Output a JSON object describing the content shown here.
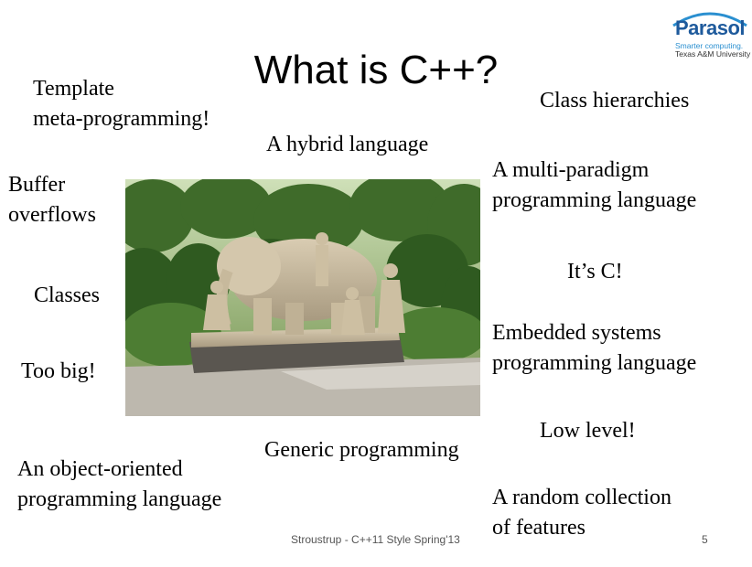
{
  "title": "What is C++?",
  "logo": {
    "name": "Parasol",
    "tagline_line1": "Smarter computing.",
    "tagline_line2": "Texas A&M University",
    "color_primary": "#1e5a9c",
    "color_tagline1": "#2a8fd0"
  },
  "phrases": {
    "template_meta": "Template\nmeta-programming!",
    "class_hierarchies": "Class hierarchies",
    "hybrid": "A hybrid language",
    "multi_paradigm": "A multi-paradigm\nprogramming language",
    "buffer": "Buffer\noverflows",
    "its_c": "It’s C!",
    "classes": "Classes",
    "embedded": "Embedded systems\nprogramming language",
    "too_big": "Too big!",
    "low_level": "Low level!",
    "generic": "Generic programming",
    "object_oriented": "An object-oriented\nprogramming language",
    "random": "A random collection\nof features"
  },
  "footer": {
    "caption": "Stroustrup - C++11 Style Spring'13",
    "page_number": "5"
  },
  "image": {
    "subject": "stone-sculpture-blind-men-and-elephant-photo"
  }
}
